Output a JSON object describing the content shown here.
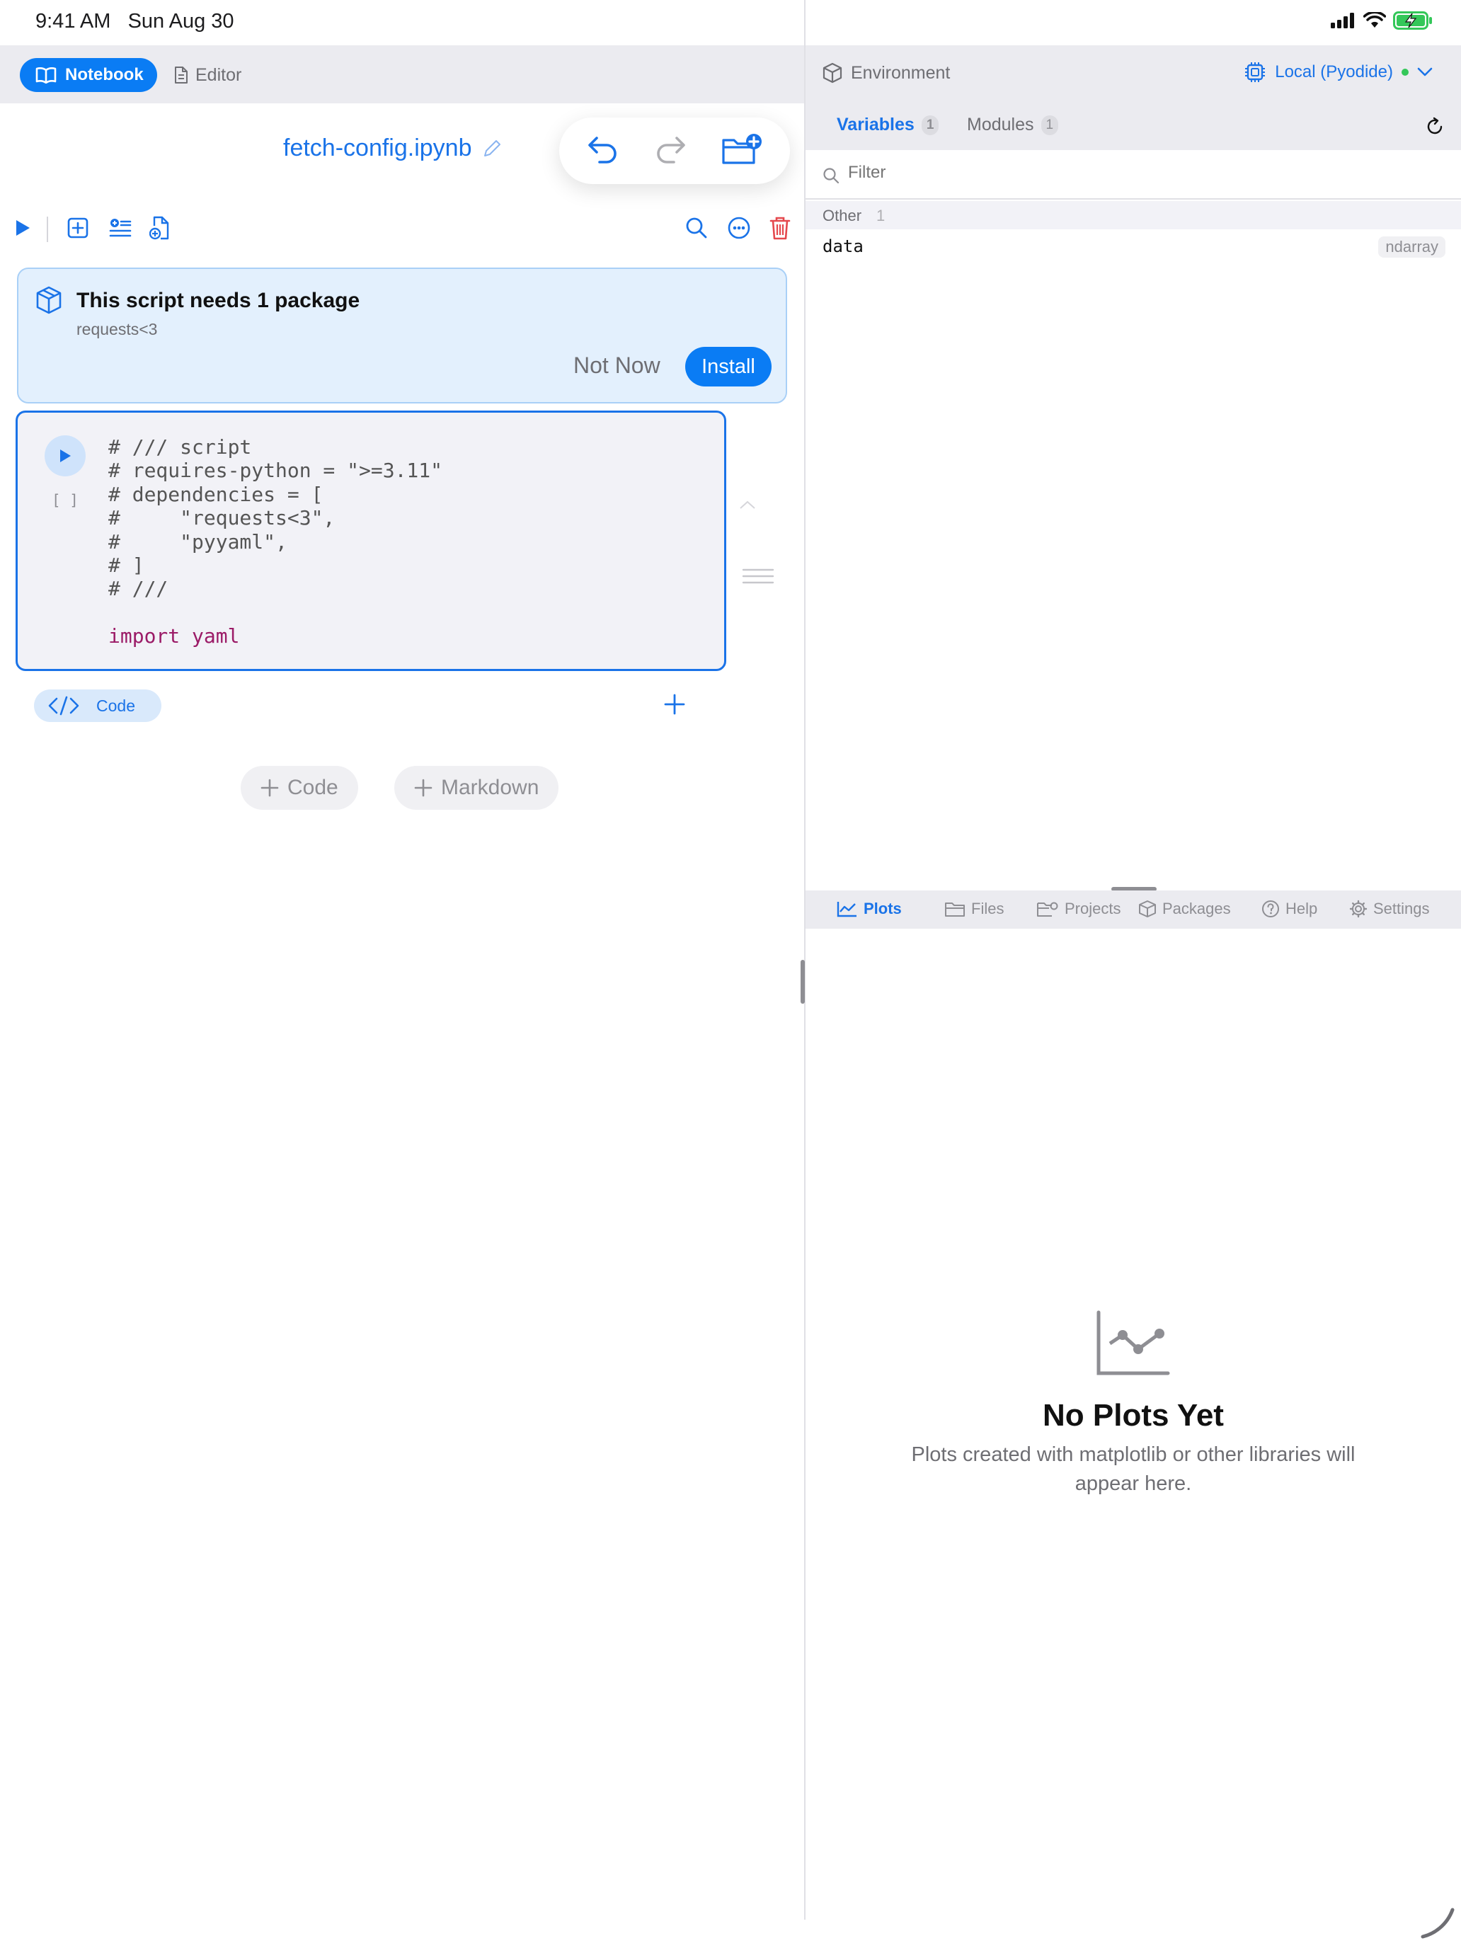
{
  "status_bar": {
    "time": "9:41 AM",
    "date": "Sun Aug 30"
  },
  "left_header": {
    "notebook_tab": "Notebook",
    "editor_tab": "Editor"
  },
  "notebook": {
    "title": "fetch-config.ipynb"
  },
  "package_banner": {
    "title": "This script needs 1 package",
    "subtitle": "requests<3",
    "not_now_label": "Not Now",
    "install_label": "Install"
  },
  "cell": {
    "execution_count": "[ ]",
    "code_lines": [
      "# /// script",
      "# requires-python = \">=3.11\"",
      "# dependencies = [",
      "#     \"requests<3\",",
      "#     \"pyyaml\",",
      "# ]",
      "# ///",
      "",
      "import yaml"
    ],
    "type_label": "Code"
  },
  "add_buttons": {
    "code": "Code",
    "markdown": "Markdown"
  },
  "environment": {
    "label": "Environment",
    "kernel": "Local (Pyodide)",
    "kernel_status_color": "#34c759"
  },
  "right_tabs": {
    "variables": {
      "label": "Variables",
      "count": "1"
    },
    "modules": {
      "label": "Modules",
      "count": "1"
    }
  },
  "filter": {
    "placeholder": "Filter"
  },
  "variables": {
    "section_title": "Other",
    "section_count": "1",
    "items": [
      {
        "name": "data",
        "type": "ndarray"
      }
    ]
  },
  "bottom_tabs": {
    "plots": "Plots",
    "files": "Files",
    "projects": "Projects",
    "packages": "Packages",
    "help": "Help",
    "settings": "Settings"
  },
  "plots_empty": {
    "title": "No Plots Yet",
    "line1": "Plots created with matplotlib or other libraries will",
    "line2": "appear here."
  },
  "colors": {
    "accent": "#1a73e8",
    "accent_button": "#0a7cf4",
    "danger": "#e5484d"
  }
}
